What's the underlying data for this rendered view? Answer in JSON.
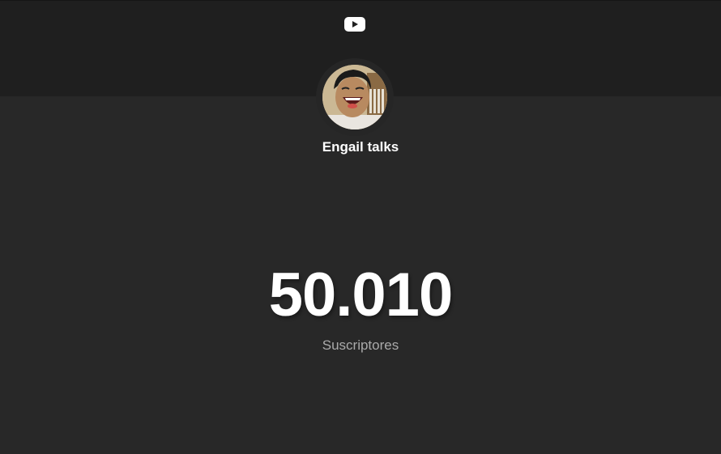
{
  "header": {
    "logo_icon": "youtube-play-icon"
  },
  "channel": {
    "avatar_icon": "channel-avatar",
    "name": "Engail talks"
  },
  "stats": {
    "subscriber_count": "50.010",
    "subscriber_label": "Suscriptores"
  },
  "colors": {
    "background": "#282828",
    "header_band": "#1f1f1f",
    "text_primary": "#ffffff",
    "text_secondary": "#aaaaaa"
  }
}
